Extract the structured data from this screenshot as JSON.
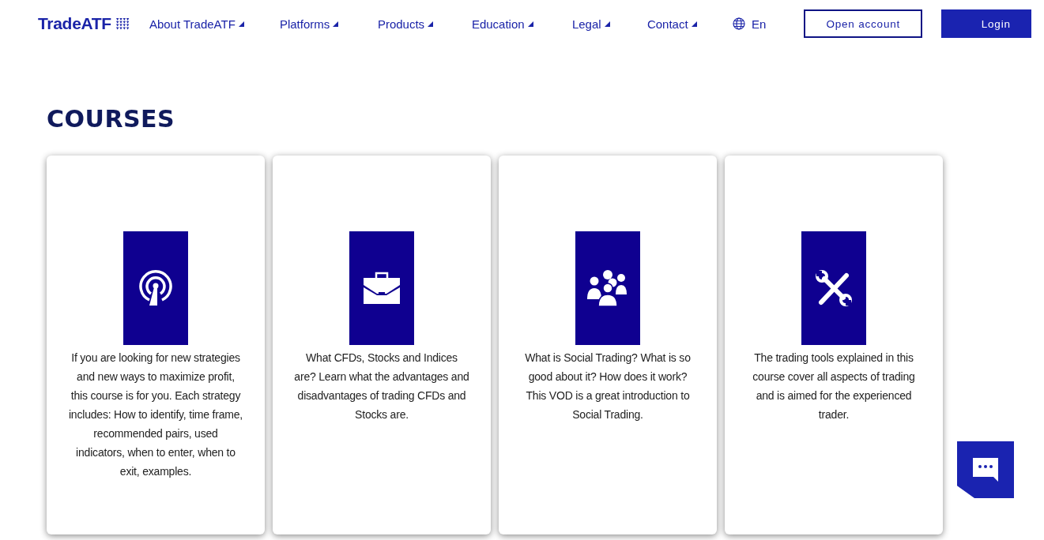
{
  "header": {
    "logo": "TradeATF",
    "nav": [
      {
        "label": "About TradeATF"
      },
      {
        "label": "Platforms"
      },
      {
        "label": "Products"
      },
      {
        "label": "Education"
      },
      {
        "label": "Legal"
      },
      {
        "label": "Contact"
      }
    ],
    "language": "En",
    "open_account": "Open account",
    "login": "Login"
  },
  "section": {
    "title": "COURSES",
    "cards": [
      {
        "kind": "antenna",
        "text": "If you are looking for new strategies and new ways to maximize profit, this course is for you. Each strategy includes: How to identify, time frame, recommended pairs, used indicators, when to enter, when to exit, examples."
      },
      {
        "kind": "briefcase",
        "text": "What CFDs, Stocks and Indices are? Learn what the advantages and disadvantages of trading CFDs and Stocks are."
      },
      {
        "kind": "people",
        "text": "What is Social Trading? What is so good about it? How does it work? This VOD is a great introduction to Social Trading."
      },
      {
        "kind": "tools",
        "text": "The trading tools explained in this course cover all aspects of trading and is aimed for the experienced trader."
      }
    ]
  }
}
